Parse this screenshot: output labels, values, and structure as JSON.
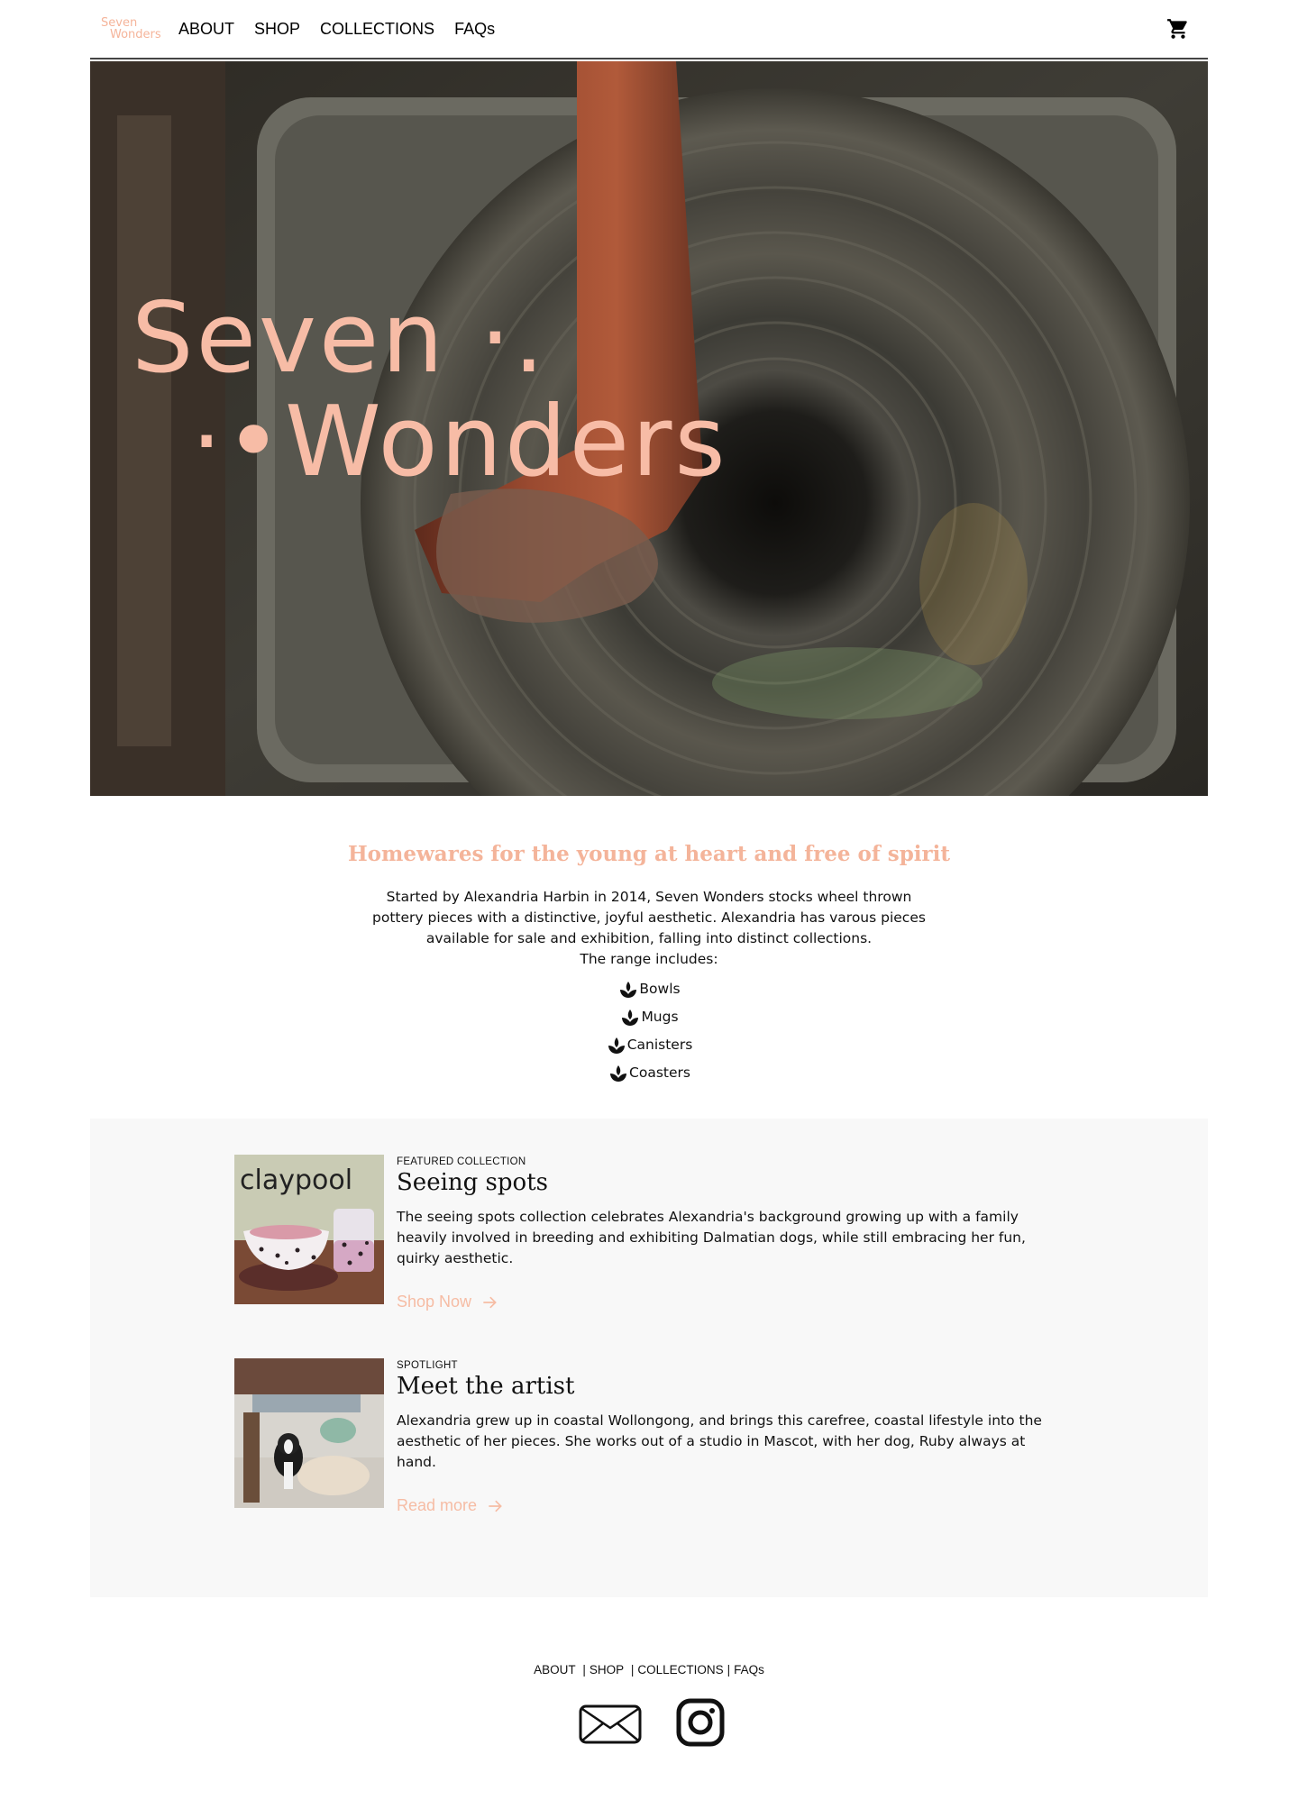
{
  "brand": {
    "logo_line1": "Seven",
    "logo_line2": "Wonders"
  },
  "nav": {
    "items": [
      {
        "label": "ABOUT"
      },
      {
        "label": "SHOP"
      },
      {
        "label": "COLLECTIONS"
      },
      {
        "label": "FAQs"
      }
    ],
    "cart_icon": "shopping-cart-icon"
  },
  "hero": {
    "title_line1": "Seven ·.",
    "title_line2": "·•Wonders"
  },
  "intro": {
    "tagline": "Homewares for the young at heart and free of spirit",
    "description": "Started by Alexandria Harbin in 2014, Seven Wonders stocks wheel thrown pottery pieces with a distinctive, joyful aesthetic. Alexandria has varous pieces available for sale and exhibition, falling into distinct collections.",
    "range_heading": "The range includes:",
    "range_icon": "leaf-sprout-icon",
    "range_items": [
      "Bowls",
      "Mugs",
      "Canisters",
      "Coasters"
    ]
  },
  "features": [
    {
      "kicker": "FEATURED COLLECTION",
      "title": "Seeing spots",
      "text": "The seeing spots collection celebrates Alexandria's background growing up with a family heavily involved in breeding and exhibiting Dalmatian dogs, while still embracing her fun, quirky aesthetic.",
      "link": "Shop Now",
      "image_caption": "claypool"
    },
    {
      "kicker": "SPOTLIGHT",
      "title": "Meet the artist",
      "text": "Alexandria grew up in coastal Wollongong, and brings this carefree, coastal lifestyle into the aesthetic of her pieces. She works out of a studio in Mascot, with her dog, Ruby always at hand.",
      "link": "Read more"
    }
  ],
  "footer": {
    "links": [
      "ABOUT",
      "SHOP",
      "COLLECTIONS",
      "FAQs"
    ],
    "icons": [
      "envelope-icon",
      "instagram-icon"
    ]
  },
  "colors": {
    "accent": "#f4b49a",
    "panel_bg": "#f8f8f8",
    "text": "#111111"
  }
}
